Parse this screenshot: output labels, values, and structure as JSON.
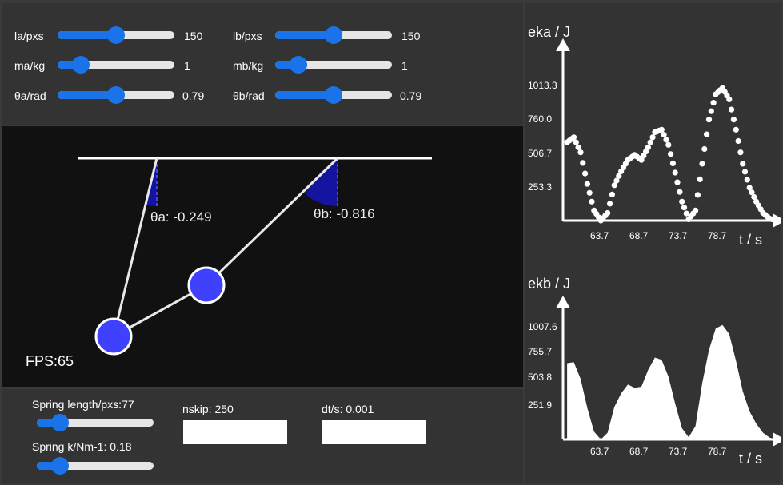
{
  "controls": {
    "la": {
      "label": "la/pxs",
      "value": "150",
      "fraction": 0.5
    },
    "lb": {
      "label": "lb/pxs",
      "value": "150",
      "fraction": 0.5
    },
    "ma": {
      "label": "ma/kg",
      "value": "1",
      "fraction": 0.2
    },
    "mb": {
      "label": "mb/kg",
      "value": "1",
      "fraction": 0.2
    },
    "theta_a": {
      "label": "θa/rad",
      "value": "0.79",
      "fraction": 0.5
    },
    "theta_b": {
      "label": "θb/rad",
      "value": "0.79",
      "fraction": 0.5
    }
  },
  "simulation": {
    "angle_a_label": "θa: -0.249",
    "angle_b_label": "θb: -0.816",
    "fps": "FPS:65",
    "ball_color": "#4040ff",
    "arc_color": "#1414a0"
  },
  "bottom": {
    "spring_length": {
      "label": "Spring length/pxs:77",
      "fraction": 0.2
    },
    "spring_k": {
      "label": "Spring k/Nm-1: 0.18",
      "fraction": 0.2
    },
    "nskip_label": "nskip: 250",
    "nskip_value": "",
    "dt_label": "dt/s: 0.001",
    "dt_value": ""
  },
  "charts": {
    "eka": {
      "title": "eka / J",
      "xlabel": "t / s",
      "yticks": [
        "253.3",
        "506.7",
        "760.0",
        "1013.3"
      ],
      "xticks": [
        "63.7",
        "68.7",
        "73.7",
        "78.7"
      ]
    },
    "ekb": {
      "title": "ekb / J",
      "xlabel": "t / s",
      "yticks": [
        "251.9",
        "503.8",
        "755.7",
        "1007.6"
      ],
      "xticks": [
        "63.7",
        "68.7",
        "73.7",
        "78.7"
      ]
    }
  },
  "chart_data": [
    {
      "type": "scatter",
      "title": "eka / J",
      "xlabel": "t / s",
      "ylabel": "eka / J",
      "ylim": [
        0,
        1140
      ],
      "xlim": [
        59.1,
        84.1
      ],
      "x": [
        59.2,
        60.0,
        60.8,
        61.6,
        62.4,
        63.2,
        64.0,
        64.8,
        65.6,
        66.4,
        67.2,
        68.0,
        68.8,
        69.6,
        70.4,
        71.2,
        72.0,
        72.8,
        73.6,
        74.4,
        75.2,
        76.0,
        76.8,
        77.6,
        78.4,
        79.2,
        80.0,
        80.8,
        81.6,
        82.4,
        83.2,
        84.0
      ],
      "y": [
        620,
        660,
        540,
        290,
        80,
        0,
        60,
        280,
        390,
        480,
        520,
        480,
        580,
        700,
        720,
        600,
        380,
        150,
        10,
        80,
        450,
        800,
        1000,
        1050,
        960,
        720,
        450,
        260,
        150,
        60,
        15,
        0
      ]
    },
    {
      "type": "area",
      "title": "ekb / J",
      "xlabel": "t / s",
      "ylabel": "ekb / J",
      "ylim": [
        0,
        1140
      ],
      "xlim": [
        59.1,
        84.1
      ],
      "x": [
        59.2,
        60.0,
        60.8,
        61.6,
        62.4,
        63.2,
        64.0,
        64.8,
        65.6,
        66.4,
        67.2,
        68.0,
        68.8,
        69.6,
        70.4,
        71.2,
        72.0,
        72.8,
        73.6,
        74.4,
        75.2,
        76.0,
        76.8,
        77.6,
        78.4,
        79.2,
        80.0,
        80.8,
        81.6,
        82.4,
        83.2,
        84.0
      ],
      "y": [
        680,
        690,
        540,
        280,
        70,
        0,
        60,
        290,
        410,
        490,
        460,
        470,
        620,
        730,
        710,
        560,
        320,
        100,
        20,
        120,
        500,
        800,
        990,
        1020,
        940,
        700,
        430,
        250,
        140,
        60,
        15,
        0
      ]
    }
  ]
}
